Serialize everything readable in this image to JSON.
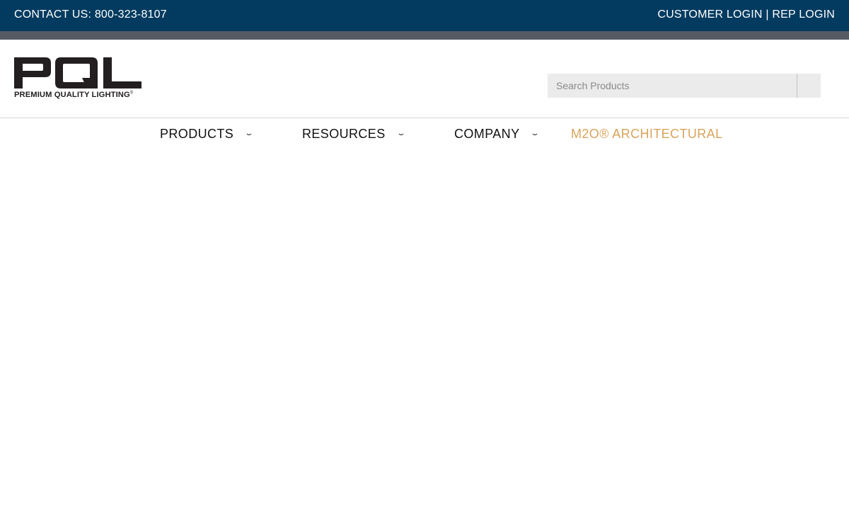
{
  "topbar": {
    "contact_text": "CONTACT US: 800-323-8107",
    "customer_login": "CUSTOMER LOGIN",
    "separator": "|",
    "rep_login": "REP LOGIN",
    "background_color": "#033b60"
  },
  "brand": {
    "logo_letters": "PQL",
    "tagline": "PREMIUM QUALITY LIGHTING",
    "registered_mark": "®"
  },
  "search": {
    "placeholder": "Search Products",
    "value": ""
  },
  "nav": {
    "items": [
      {
        "label": "PRODUCTS",
        "has_dropdown": true,
        "icon": "chevron-down-icon"
      },
      {
        "label": "RESOURCES",
        "has_dropdown": true,
        "icon": "chevron-down-icon"
      },
      {
        "label": "COMPANY",
        "has_dropdown": true,
        "icon": "chevron-down-icon"
      },
      {
        "label": "M2O® ARCHITECTURAL",
        "has_dropdown": false
      }
    ],
    "accent_color": "#d9a35a"
  }
}
